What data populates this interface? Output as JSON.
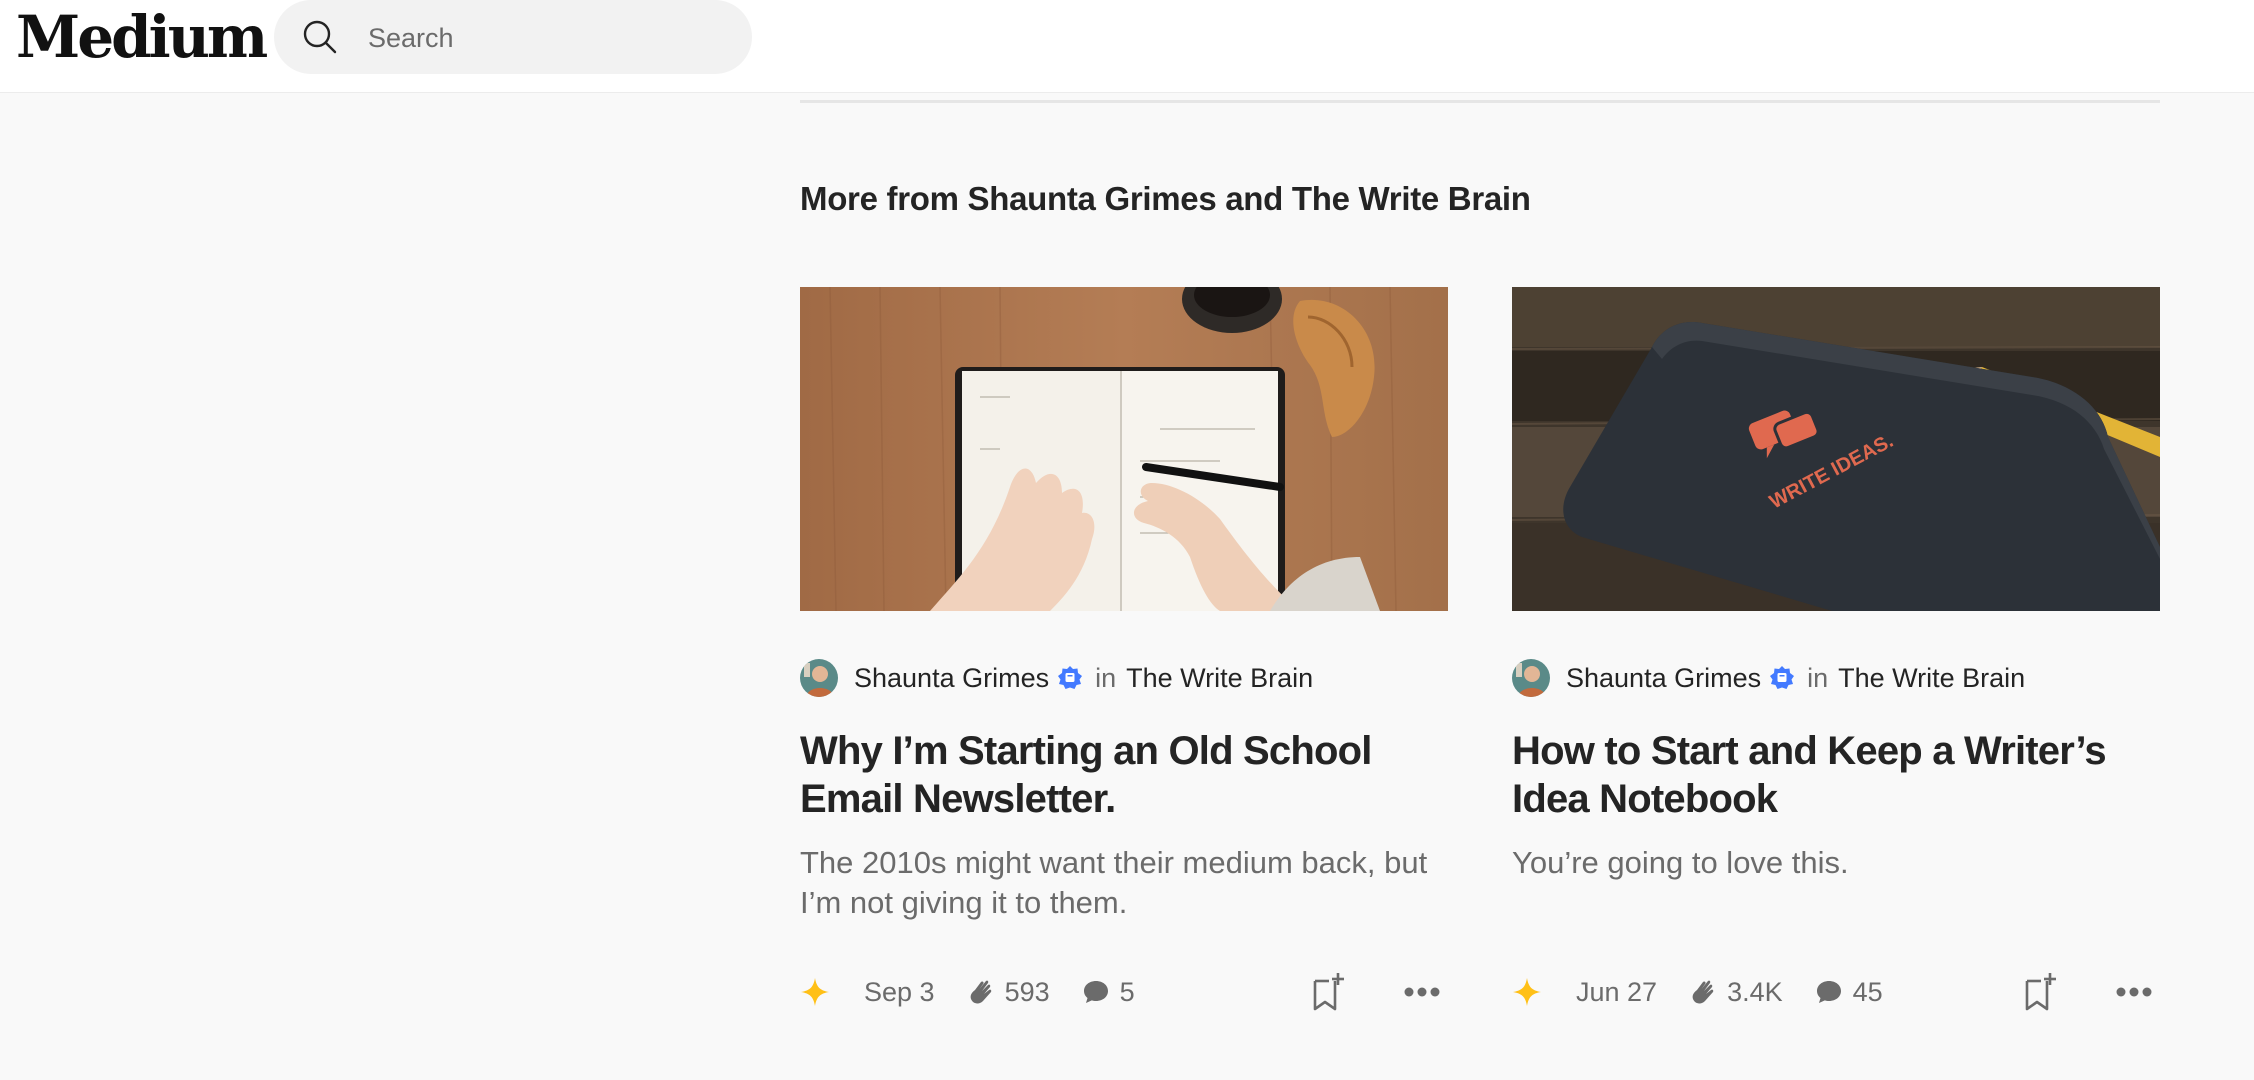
{
  "header": {
    "logo": "Medium",
    "search_placeholder": "Search"
  },
  "section": {
    "title": "More from Shaunta Grimes and The Write Brain"
  },
  "cards": [
    {
      "author": "Shaunta Grimes",
      "in_label": "in",
      "publication": "The Write Brain",
      "title": "Why I’m Starting an Old School Email Newsletter.",
      "subtitle": "The 2010s might want their medium back, but I’m not giving it to them.",
      "date": "Sep 3",
      "claps": "593",
      "responses": "5",
      "image": "notebook-writing-photo"
    },
    {
      "author": "Shaunta Grimes",
      "in_label": "in",
      "publication": "The Write Brain",
      "title": "How to Start and Keep a Writer’s Idea Notebook",
      "subtitle": "You’re going to love this.",
      "date": "Jun 27",
      "claps": "3.4K",
      "responses": "45",
      "image": "write-ideas-notebook-photo"
    }
  ],
  "colors": {
    "accent_star": "#ffc017",
    "badge": "#437aff",
    "text_primary": "#242424",
    "text_secondary": "#6b6b6b"
  }
}
